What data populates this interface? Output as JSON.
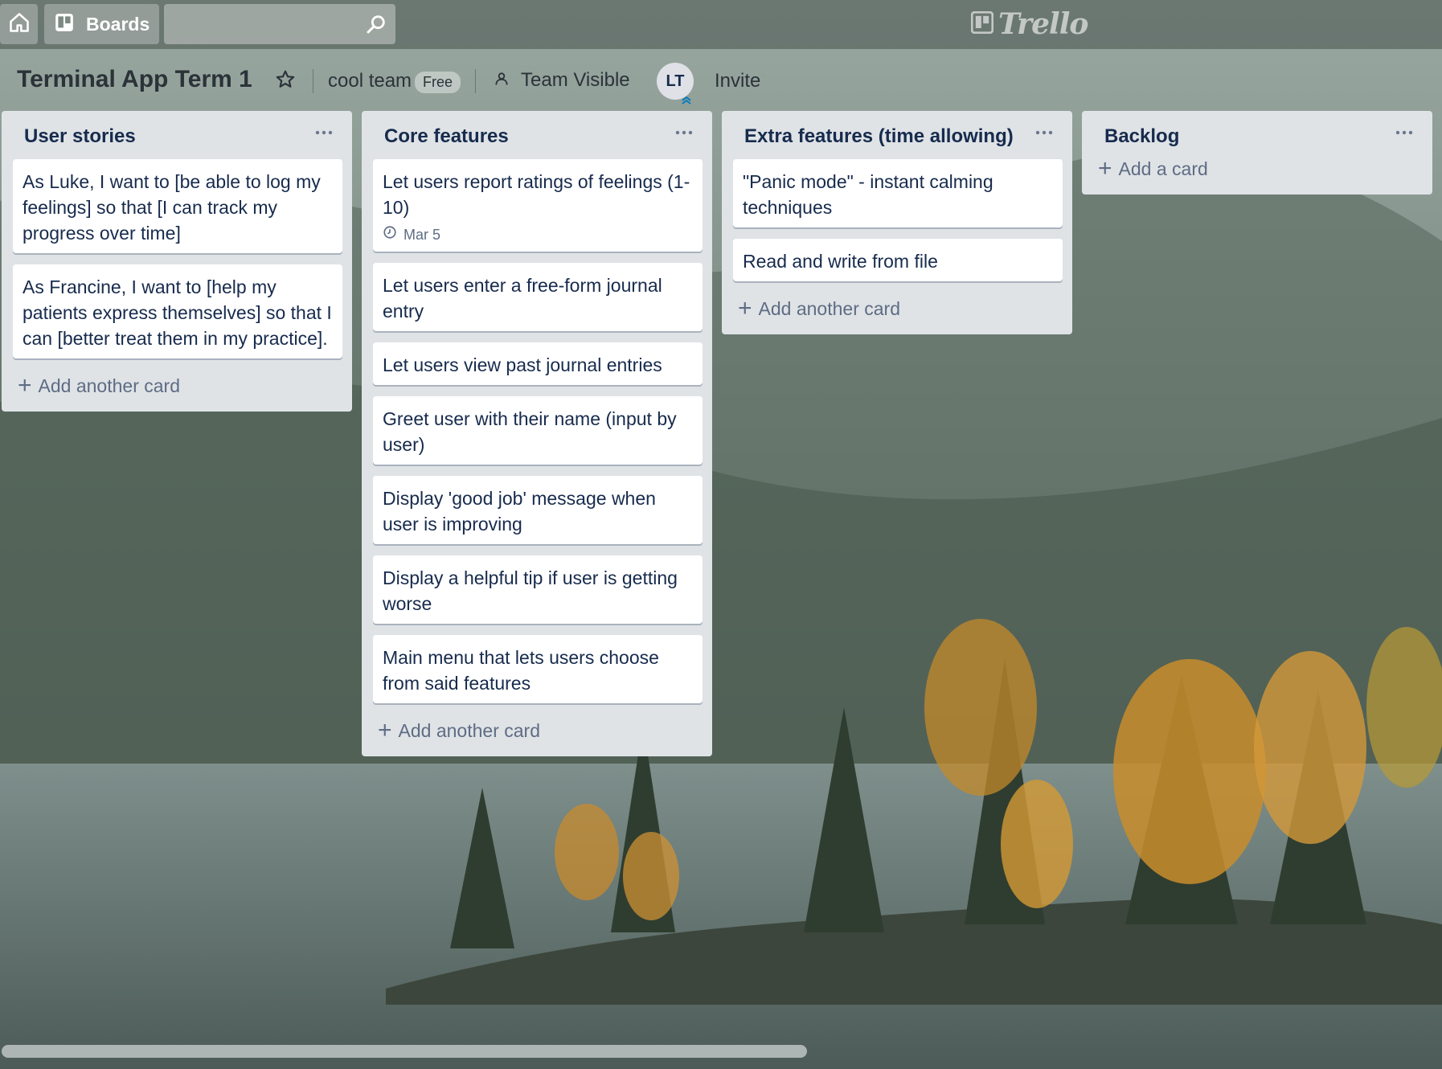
{
  "topbar": {
    "home_icon": "home-icon",
    "boards_label": "Boards",
    "boards_icon": "boards-icon",
    "search": {
      "value": "",
      "placeholder": "",
      "icon": "search-icon"
    },
    "logo_text": "Trello",
    "logo_icon": "trello-logo-icon"
  },
  "board": {
    "title": "Terminal App Term 1",
    "star_icon": "star-icon",
    "team_name": "cool team",
    "plan_badge": "Free",
    "visibility_icon": "team-visibility-icon",
    "visibility_label": "Team Visible",
    "member_initials": "LT",
    "invite_label": "Invite"
  },
  "lists": [
    {
      "title": "User stories",
      "cards": [
        {
          "text": "As Luke, I want to [be able to log my feelings] so that [I can track my progress over time]"
        },
        {
          "text": "As Francine, I want to [help my patients express themselves] so that I can [better treat them in my practice]."
        }
      ],
      "add_label": "Add another card"
    },
    {
      "title": "Core features",
      "cards": [
        {
          "text": "Let users report ratings of feelings (1-10)",
          "due": "Mar 5"
        },
        {
          "text": "Let users enter a free-form journal entry"
        },
        {
          "text": "Let users view past journal entries"
        },
        {
          "text": "Greet user with their name (input by user)"
        },
        {
          "text": "Display 'good job' message when user is improving"
        },
        {
          "text": "Display a helpful tip if user is getting worse"
        },
        {
          "text": "Main menu that lets users choose from said features"
        }
      ],
      "add_label": "Add another card"
    },
    {
      "title": "Extra features (time allowing)",
      "cards": [
        {
          "text": "\"Panic mode\" - instant calming techniques"
        },
        {
          "text": "Read and write from file"
        }
      ],
      "add_label": "Add another card"
    },
    {
      "title": "Backlog",
      "cards": [],
      "add_label": "Add a card"
    }
  ],
  "scrollbar": {
    "position_fraction": 0.0,
    "visible_fraction": 0.56
  }
}
